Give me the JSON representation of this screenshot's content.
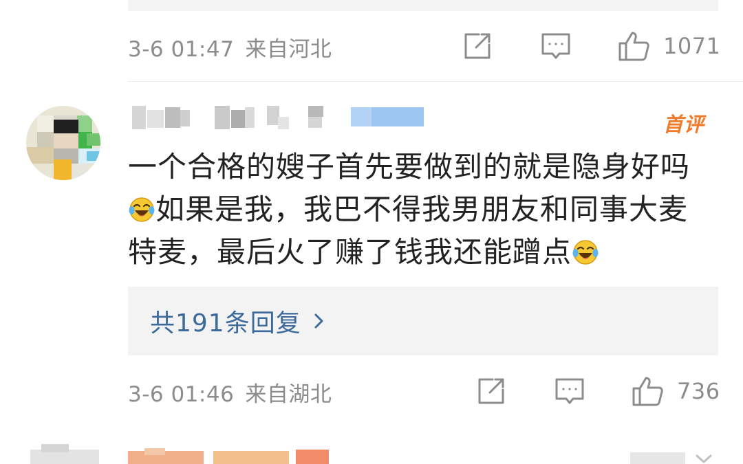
{
  "previous_comment": {
    "time": "3-6 01:47",
    "location": "来自河北",
    "like_count": "1071",
    "icons": [
      "share-icon",
      "comment-icon",
      "like-icon"
    ]
  },
  "comment": {
    "username": "",
    "badge": "首评",
    "text_lines": [
      "一个合格的嫂子首先要做到的就是隐身好吗",
      "如果是我，我巴不得我男朋友和同事大麦",
      "特麦，最后火了赚了钱我还能蹭点"
    ],
    "emoji": "laughing-crying-emoji",
    "replies_label": "共191条回复",
    "time": "3-6 01:46",
    "location": "来自湖北",
    "like_count": "736",
    "icons": [
      "share-icon",
      "comment-icon",
      "like-icon"
    ]
  },
  "colors": {
    "meta_text": "#8c8c8c",
    "reply_link": "#3c6a9b",
    "badge": "#f07a2a",
    "reply_box_bg": "#f3f3f3",
    "comment_text": "#222222"
  }
}
